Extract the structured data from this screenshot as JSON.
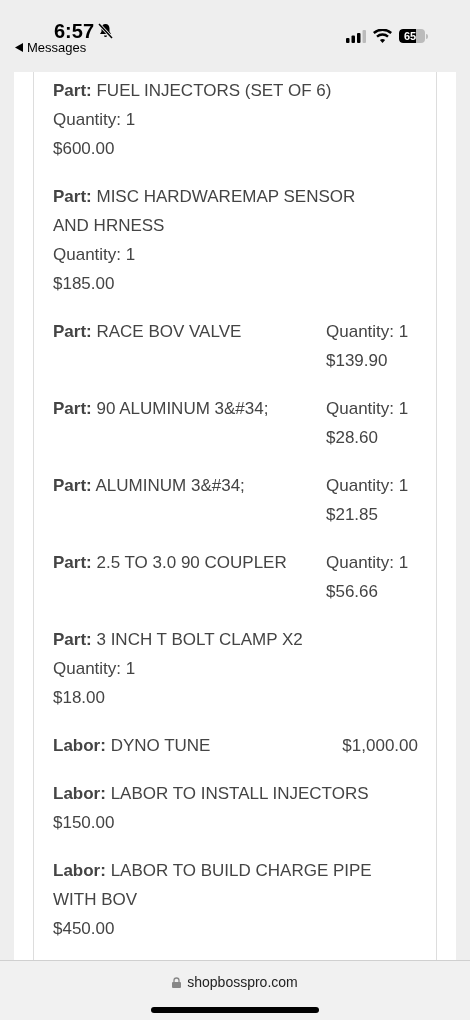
{
  "status_bar": {
    "time": "6:57",
    "back_label": "Messages",
    "battery": "65"
  },
  "items": [
    {
      "kind": "stacked",
      "label": "Part:",
      "name": "FUEL INJECTORS (SET OF 6)",
      "quantity": "Quantity: 1",
      "price": "$600.00"
    },
    {
      "kind": "stacked",
      "label": "Part:",
      "name": "MISC HARDWAREMAP SENSOR AND HRNESS",
      "quantity": "Quantity: 1",
      "price": "$185.00"
    },
    {
      "kind": "split",
      "label": "Part:",
      "name": "RACE BOV VALVE",
      "quantity": "Quantity: 1",
      "price": "$139.90"
    },
    {
      "kind": "split",
      "label": "Part:",
      "name": "90 ALUMINUM 3&#34;",
      "quantity": "Quantity: 1",
      "price": "$28.60"
    },
    {
      "kind": "split",
      "label": "Part:",
      "name": "ALUMINUM 3&#34;",
      "quantity": "Quantity: 1",
      "price": "$21.85"
    },
    {
      "kind": "split",
      "label": "Part:",
      "name": "2.5 TO 3.0 90 COUPLER",
      "quantity": "Quantity: 1",
      "price": "$56.66"
    },
    {
      "kind": "stacked",
      "label": "Part:",
      "name": "3 INCH T BOLT CLAMP X2",
      "quantity": "Quantity: 1",
      "price": "$18.00"
    },
    {
      "kind": "row",
      "label": "Labor:",
      "name": "DYNO TUNE",
      "price": "$1,000.00"
    },
    {
      "kind": "stacked",
      "label": "Labor:",
      "name": "LABOR TO INSTALL INJECTORS",
      "price": "$150.00"
    },
    {
      "kind": "stacked",
      "label": "Labor:",
      "name": "LABOR TO BUILD CHARGE PIPE WITH BOV",
      "price": "$450.00"
    }
  ],
  "address_bar": {
    "url": "shopbosspro.com"
  }
}
